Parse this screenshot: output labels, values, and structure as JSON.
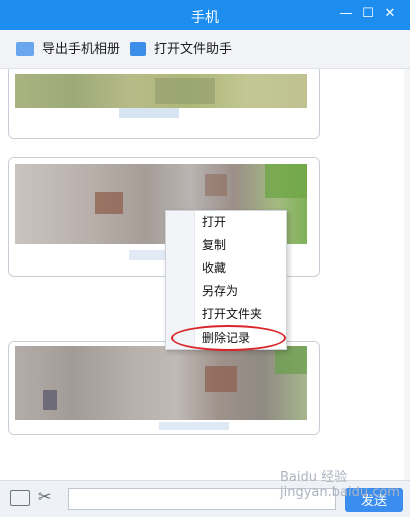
{
  "window": {
    "title": "手机"
  },
  "toolbar": {
    "export_album_label": "导出手机相册",
    "open_file_assistant_label": "打开文件助手"
  },
  "context_menu": {
    "items": [
      "打开",
      "复制",
      "收藏",
      "另存为",
      "打开文件夹",
      "删除记录"
    ]
  },
  "bottom": {
    "input_value": "",
    "send_label": "发送"
  },
  "watermark": "Baidu 经验 jingyan.baidu.com",
  "colors": {
    "titlebar": "#1e8df0",
    "accent": "#3b8ef0",
    "highlight": "#d9262a"
  }
}
